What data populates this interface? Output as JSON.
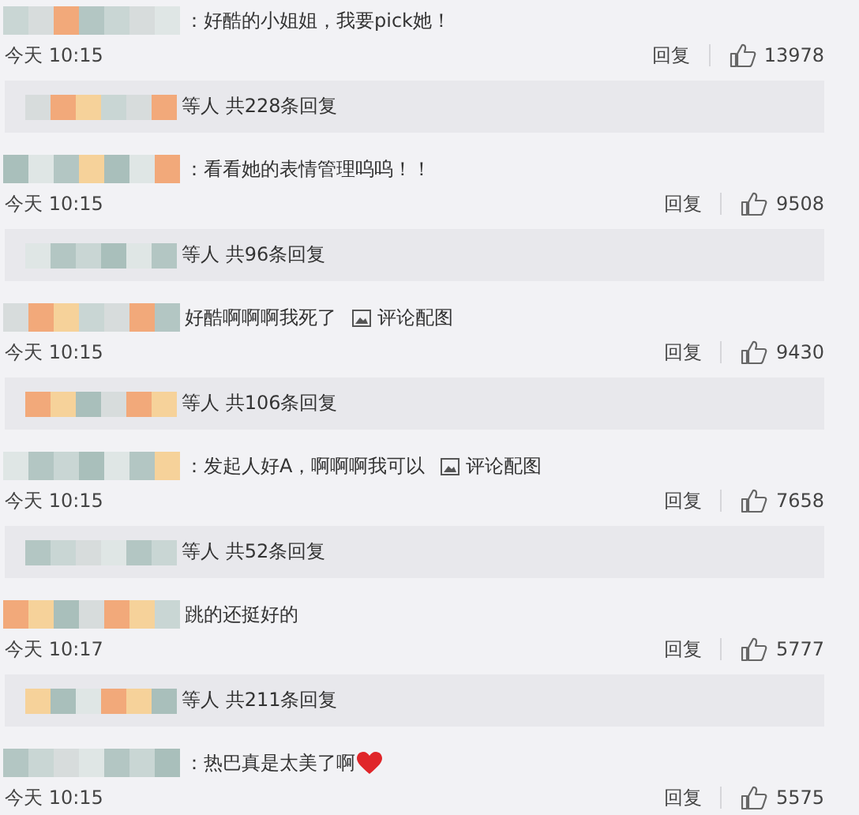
{
  "comments": [
    {
      "text": "：好酷的小姐姐，我要pick她！",
      "time": "今天 10:15",
      "reply_label": "回复",
      "likes": "13978",
      "replies_summary": "等人 共228条回复"
    },
    {
      "text": "：看看她的表情管理呜呜！！",
      "time": "今天 10:15",
      "reply_label": "回复",
      "likes": "9508",
      "replies_summary": "等人 共96条回复"
    },
    {
      "text": "好酷啊啊啊我死了",
      "image_link": "评论配图",
      "time": "今天 10:15",
      "reply_label": "回复",
      "likes": "9430",
      "replies_summary": "等人 共106条回复"
    },
    {
      "text": "：发起人好A，啊啊啊我可以",
      "image_link": "评论配图",
      "time": "今天 10:15",
      "reply_label": "回复",
      "likes": "7658",
      "replies_summary": "等人 共52条回复"
    },
    {
      "text": "跳的还挺好的",
      "time": "今天 10:17",
      "reply_label": "回复",
      "likes": "5777",
      "replies_summary": "等人 共211条回复"
    },
    {
      "text": "：热巴真是太美了啊",
      "heart_emoji": true,
      "time": "今天 10:15",
      "reply_label": "回复",
      "likes": "5575"
    }
  ]
}
